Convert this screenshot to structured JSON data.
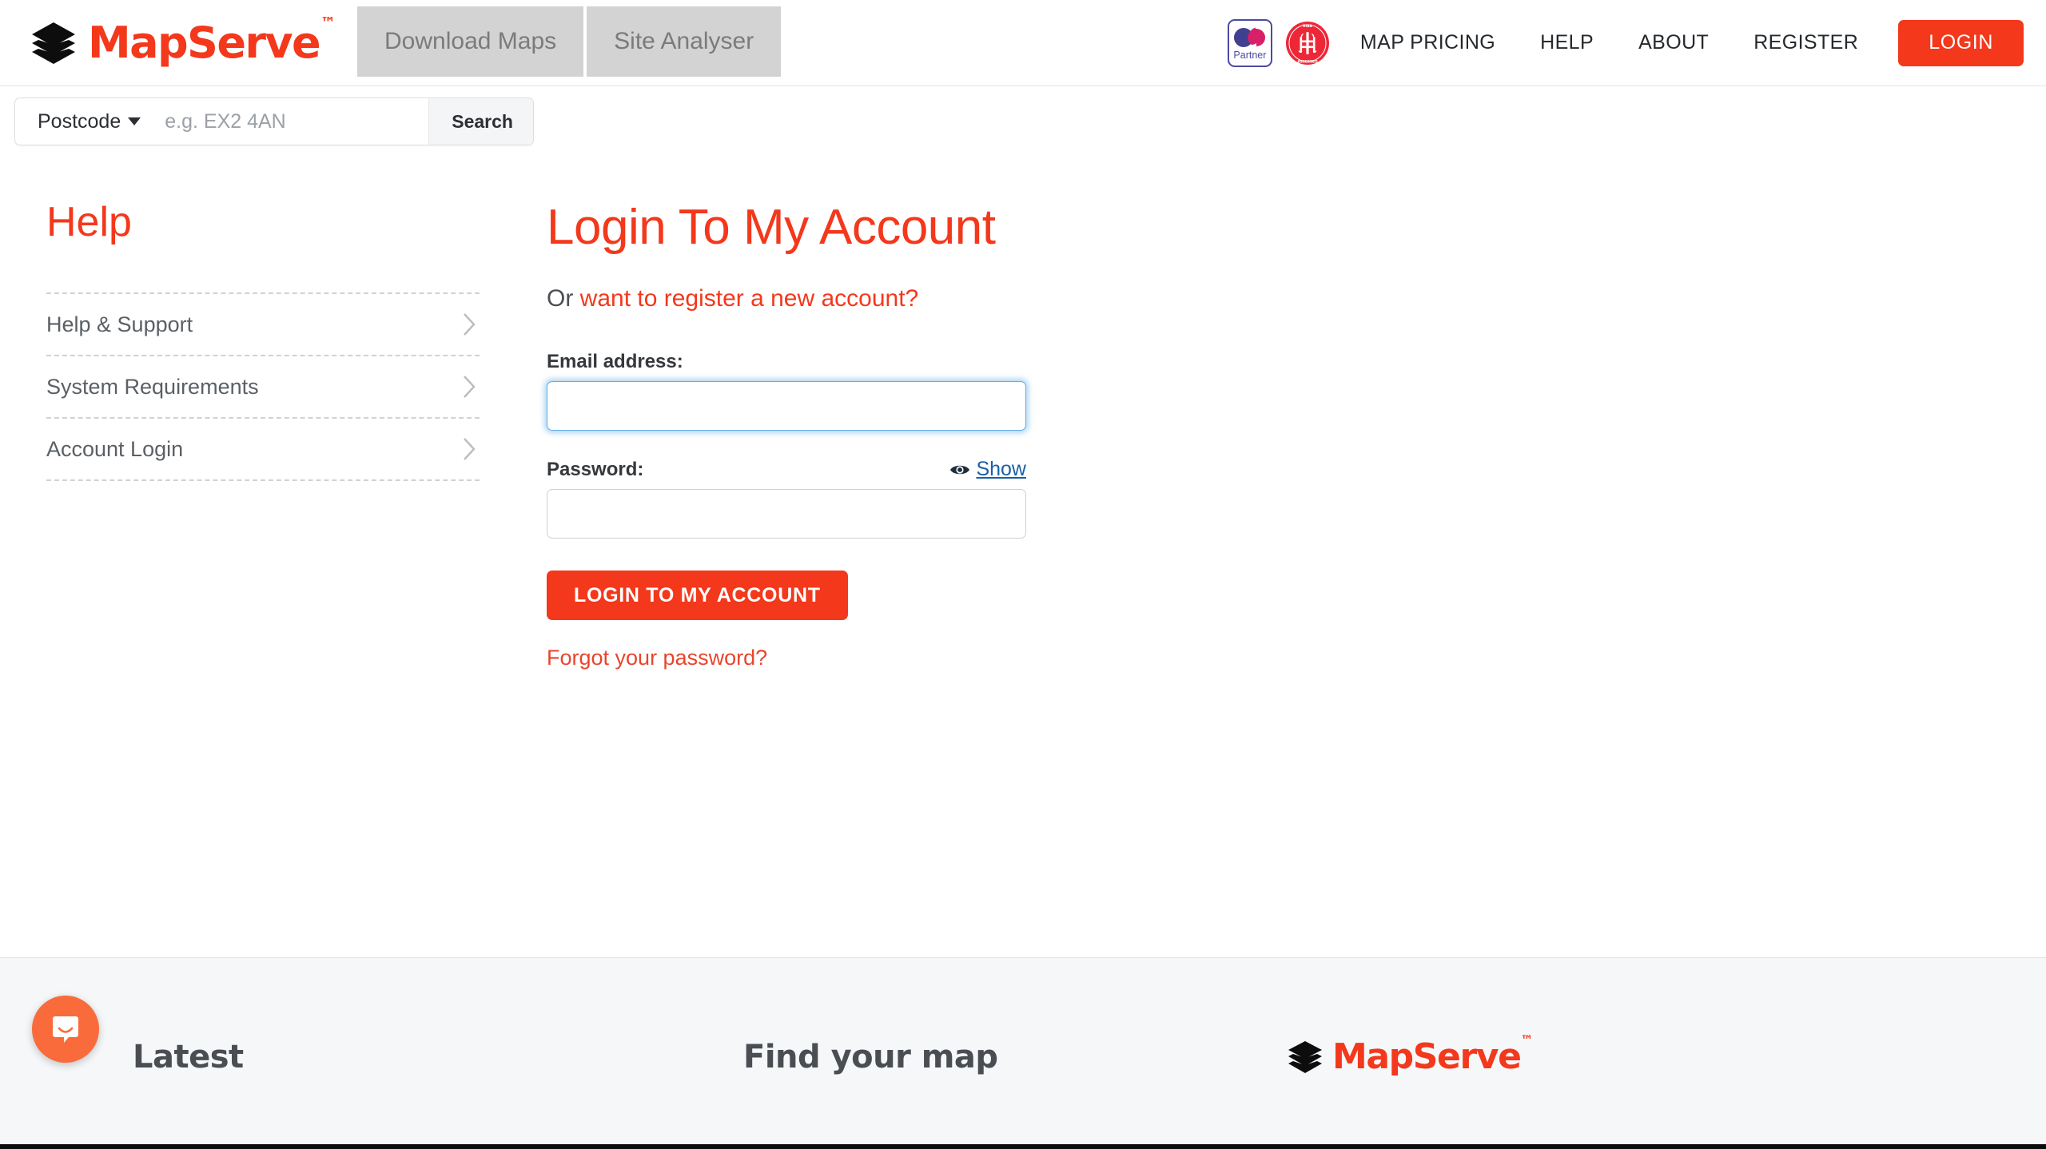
{
  "brand": {
    "name": "MapServe",
    "tm": "™",
    "logo_icon": "stacked-layers-icon",
    "color": "#f3381c"
  },
  "header": {
    "tabs": [
      {
        "label": "Download Maps"
      },
      {
        "label": "Site Analyser"
      }
    ],
    "badges": [
      {
        "name": "os-partner-badge",
        "label": "Partner",
        "mark": "OS",
        "border_color": "#4b4aa0"
      },
      {
        "name": "riba-cpd-badge",
        "text": "MATERIAL · RIBA · CPD ASSESSED",
        "color": "#ee2737"
      }
    ],
    "nav": [
      {
        "label": "MAP PRICING"
      },
      {
        "label": "HELP"
      },
      {
        "label": "ABOUT"
      },
      {
        "label": "REGISTER"
      }
    ],
    "login_button": "LOGIN"
  },
  "search": {
    "type_label": "Postcode",
    "placeholder": "e.g. EX2 4AN",
    "value": "",
    "button_label": "Search"
  },
  "sidebar": {
    "title": "Help",
    "items": [
      {
        "label": "Help & Support"
      },
      {
        "label": "System Requirements"
      },
      {
        "label": "Account Login"
      }
    ]
  },
  "main": {
    "page_title": "Login To My Account",
    "subtitle_prefix": "Or ",
    "subtitle_link": "want to register a new account?",
    "email_label": "Email address:",
    "email_value": "",
    "password_label": "Password:",
    "password_value": "",
    "show_password_label": "Show",
    "show_password_icon": "eye-icon",
    "submit_label": "LOGIN TO MY ACCOUNT",
    "forgot_label": "Forgot your password?"
  },
  "footer": {
    "latest_heading": "Latest",
    "find_heading": "Find your map",
    "logo_name": "MapServe",
    "logo_tm": "™"
  },
  "chat": {
    "launcher_icon": "intercom-chat-icon",
    "color": "#f96b3a"
  }
}
